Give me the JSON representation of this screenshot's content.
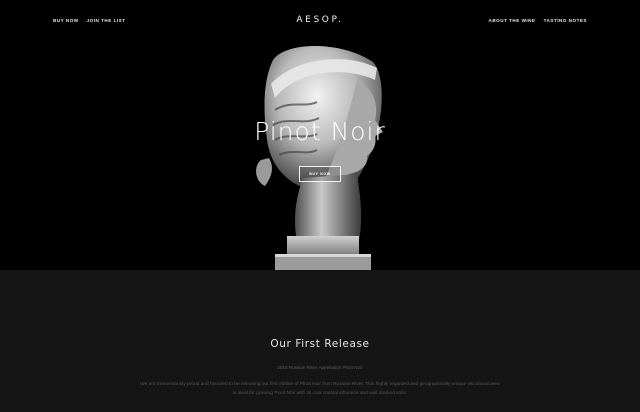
{
  "nav": {
    "left": [
      "BUY NOW",
      "JOIN THE LIST"
    ],
    "right": [
      "ABOUT THE WINE",
      "TASTING NOTES"
    ],
    "logo": "AESOP."
  },
  "hero": {
    "title": "Pinot Noir",
    "button_label": "BUY NOW"
  },
  "section": {
    "heading": "Our First Release",
    "subtitle": "2016 Russian River Appellation Pinot Noir",
    "body": "We are tremendously proud and honored to be releasing our first edition of Pinot Noir from Russian River. This highly regarded and geographically unique viticultural area is ideal for growing Pinot Noir with its cool coastal influence and well drained soils."
  },
  "colors": {
    "hero_bg": "#000000",
    "section_bg": "#151515",
    "text": "#ffffff",
    "muted": "#555555"
  }
}
